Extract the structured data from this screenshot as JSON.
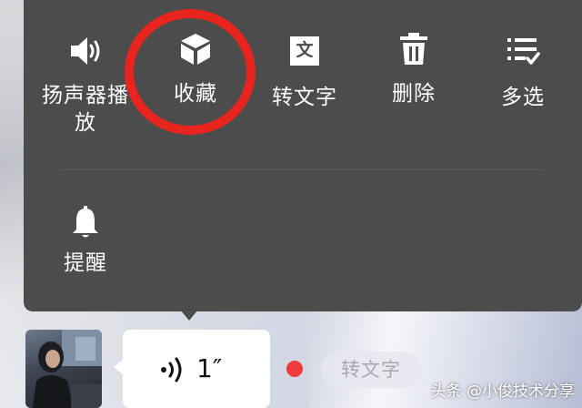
{
  "menu": {
    "row1": [
      {
        "label": "扬声器播放",
        "icon": "speaker-icon"
      },
      {
        "label": "收藏",
        "icon": "cube-icon"
      },
      {
        "label": "转文字",
        "icon": "text-convert-icon"
      },
      {
        "label": "删除",
        "icon": "trash-icon"
      },
      {
        "label": "多选",
        "icon": "checklist-icon"
      }
    ],
    "row2": [
      {
        "label": "提醒",
        "icon": "bell-icon"
      }
    ],
    "text_icon_glyph": "文",
    "speaker_label_line1": "扬声器播",
    "speaker_label_line2": "放"
  },
  "message": {
    "duration": "1″",
    "transcribe_label": "转文字"
  },
  "watermark": "头条 @小俊技术分享",
  "colors": {
    "menu_bg": "#4c4c4c",
    "annotation": "#e8241f",
    "unread_dot": "#ef3b3b"
  }
}
